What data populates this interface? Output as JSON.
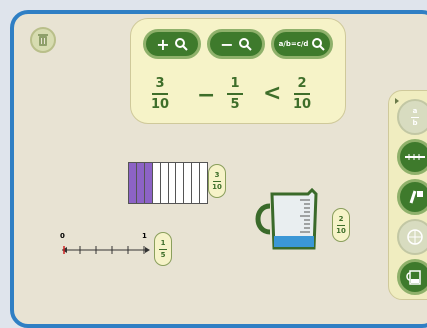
{
  "toolbar": {
    "zoom_in_label": "+",
    "zoom_out_label": "−",
    "equivalent_label": "a/b=c/d"
  },
  "comparison": {
    "left": {
      "numerator": "3",
      "denominator": "10"
    },
    "op1": "−",
    "middle": {
      "numerator": "1",
      "denominator": "5"
    },
    "op2": "<",
    "right": {
      "numerator": "2",
      "denominator": "10"
    }
  },
  "bar_model": {
    "numerator": "3",
    "denominator": "10",
    "filled": 3,
    "total": 10
  },
  "cup_model": {
    "numerator": "2",
    "denominator": "10",
    "fill_fraction": 0.2
  },
  "number_line": {
    "start": "0",
    "end": "1",
    "numerator": "1",
    "denominator": "5"
  },
  "side_tools": {
    "top_label_num": "a",
    "top_label_den": "b"
  },
  "colors": {
    "accent": "#3e7a2c",
    "frame": "#2f7fc4",
    "bar_fill": "#8c63c6",
    "liquid": "#3b97d6"
  },
  "icons": [
    "trash-icon",
    "zoom-in-icon",
    "zoom-out-icon",
    "equivalent-fraction-icon",
    "fraction-tool-icon",
    "number-line-tool-icon",
    "pie-tool-icon",
    "circle-tool-icon",
    "cup-tool-icon"
  ]
}
